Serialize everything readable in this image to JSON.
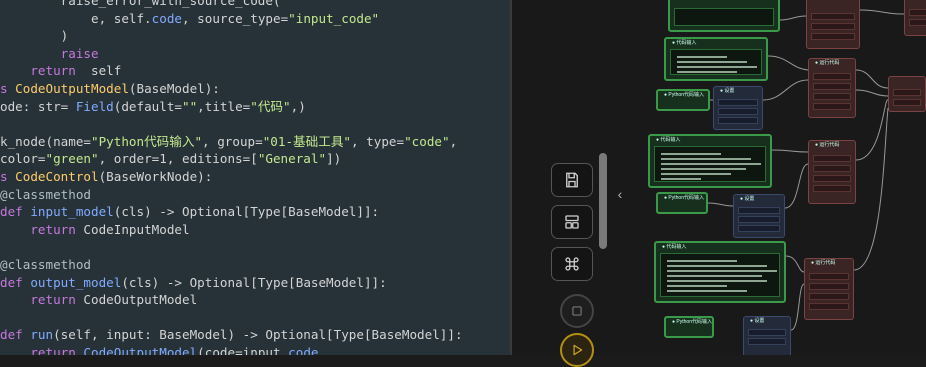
{
  "editor": {
    "lines": [
      [
        [
          "",
          "        "
        ],
        [
          "",
          "raise_error_with_source_code("
        ]
      ],
      [
        [
          "",
          "            e, self."
        ],
        [
          "fn",
          "code"
        ],
        [
          "",
          ", source_type="
        ],
        [
          "str",
          "\"input_code\""
        ]
      ],
      [
        [
          "",
          "        )"
        ]
      ],
      [
        [
          "",
          "        "
        ],
        [
          "kw",
          "raise"
        ]
      ],
      [
        [
          "",
          "    "
        ],
        [
          "kw",
          "return"
        ],
        [
          "",
          "  self"
        ]
      ],
      [
        [
          "kw",
          "s "
        ],
        [
          "cls",
          "CodeOutputModel"
        ],
        [
          "",
          "(BaseModel):"
        ]
      ],
      [
        [
          "",
          "ode: str= "
        ],
        [
          "fn",
          "Field"
        ],
        [
          "",
          "(default="
        ],
        [
          "str",
          "\"\""
        ],
        [
          "",
          ",title="
        ],
        [
          "str",
          "\"代码\""
        ],
        [
          "",
          ",)"
        ]
      ],
      [
        [
          "",
          ""
        ]
      ],
      [
        [
          "",
          "k_node(name="
        ],
        [
          "str",
          "\"Python代码输入\""
        ],
        [
          "",
          ", group="
        ],
        [
          "str",
          "\"01-基础工具\""
        ],
        [
          "",
          ", type="
        ],
        [
          "str",
          "\"code\""
        ],
        [
          "",
          ","
        ]
      ],
      [
        [
          "",
          "color="
        ],
        [
          "str",
          "\"green\""
        ],
        [
          "",
          ", order=1, editions=["
        ],
        [
          "str",
          "\"General\""
        ],
        [
          "",
          "])"
        ]
      ],
      [
        [
          "kw",
          "s "
        ],
        [
          "cls",
          "CodeControl"
        ],
        [
          "",
          "(BaseWorkNode):"
        ]
      ],
      [
        [
          "dec",
          "@classmethod"
        ]
      ],
      [
        [
          "kw",
          "def "
        ],
        [
          "fn",
          "input_model"
        ],
        [
          "",
          "(cls) -> Optional[Type[BaseModel]]:"
        ]
      ],
      [
        [
          "",
          "    "
        ],
        [
          "kw",
          "return"
        ],
        [
          "",
          " CodeInputModel"
        ]
      ],
      [
        [
          "",
          ""
        ]
      ],
      [
        [
          "dec",
          "@classmethod"
        ]
      ],
      [
        [
          "kw",
          "def "
        ],
        [
          "fn",
          "output_model"
        ],
        [
          "",
          "(cls) -> Optional[Type[BaseModel]]:"
        ]
      ],
      [
        [
          "",
          "    "
        ],
        [
          "kw",
          "return"
        ],
        [
          "",
          " CodeOutputModel"
        ]
      ],
      [
        [
          "",
          ""
        ]
      ],
      [
        [
          "kw",
          "def "
        ],
        [
          "fn",
          "run"
        ],
        [
          "",
          "(self, input: BaseModel) -> Optional[Type[BaseModel]]:"
        ]
      ],
      [
        [
          "",
          "    "
        ],
        [
          "kw",
          "return"
        ],
        [
          "fn",
          " CodeOutputModel"
        ],
        [
          "",
          "(code=input."
        ],
        [
          "fn",
          "code"
        ],
        [
          ")"
        ]
      ]
    ]
  },
  "toolbar": {
    "save": "save-icon",
    "layout": "layout-icon",
    "command": "command-icon",
    "stop": "stop-icon",
    "run": "play-icon",
    "collapse": "‹"
  },
  "colors": {
    "green_node": "#3b9a4a",
    "red_node": "#7b4343",
    "blue_node": "#3b4a6e"
  }
}
